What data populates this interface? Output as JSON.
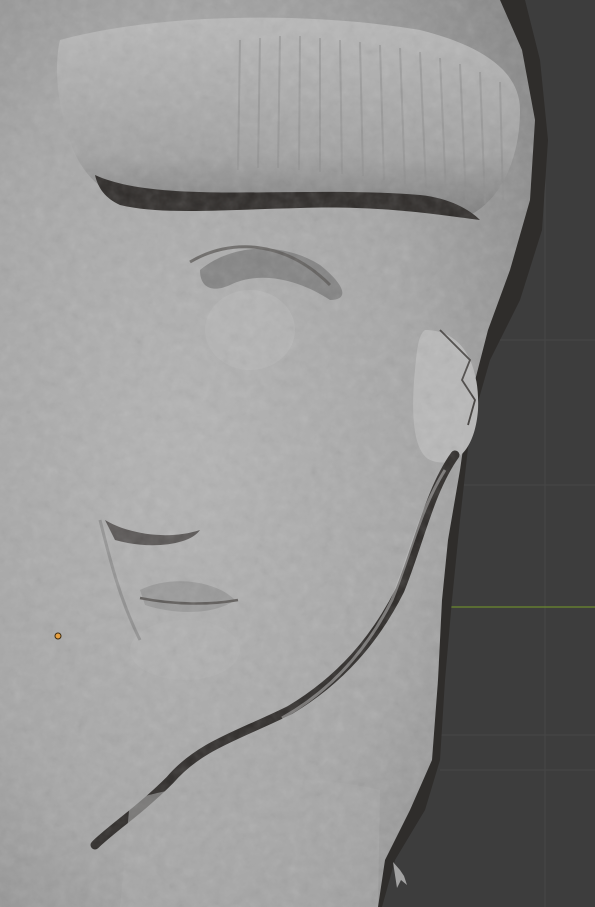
{
  "viewport": {
    "background_color": "#3d3d3d",
    "grid_line_color": "#4a4a4a",
    "x_axis_color": "#6b8a2e",
    "mesh_color": "#a3a3a3",
    "mesh_highlight_color": "#bdbdbd",
    "mesh_shadow_color": "#2e2b29",
    "origin_marker_color": "#e8a040",
    "icons": [
      "origin-marker-icon",
      "cursor-arrow-icon"
    ]
  }
}
